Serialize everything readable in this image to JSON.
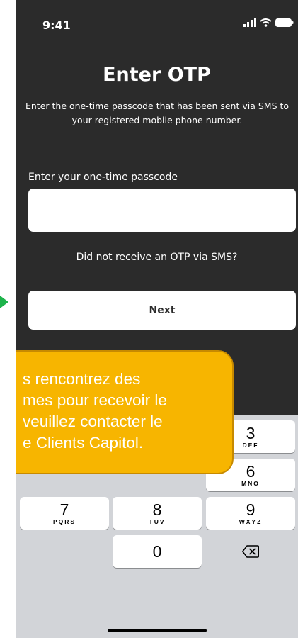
{
  "status_bar": {
    "time": "9:41",
    "icons": [
      "signal-icon",
      "wifi-icon",
      "battery-icon"
    ]
  },
  "screen": {
    "title": "Enter OTP",
    "subtitle_line1": "Enter the one-time passcode that has been sent via SMS to",
    "subtitle_line2": "your registered mobile phone number.",
    "field_label": "Enter your one-time passcode",
    "otp_value": "",
    "resend_link": "Did not receive an OTP via SMS?",
    "next_label": "Next"
  },
  "keyboard": {
    "key_3": {
      "num": "3",
      "letters": "DEF"
    },
    "key_6": {
      "num": "6",
      "letters": "MNO"
    },
    "key_7": {
      "num": "7",
      "letters": "PQRS"
    },
    "key_8": {
      "num": "8",
      "letters": "TUV"
    },
    "key_9": {
      "num": "9",
      "letters": "WXYZ"
    },
    "key_0": {
      "num": "0"
    },
    "delete_icon": "backspace-icon"
  },
  "callout": {
    "line1": "s rencontrez des",
    "line2": "mes pour recevoir le",
    "line3": "veuillez contacter le",
    "line4": "e Clients Capitol."
  },
  "colors": {
    "screen_bg": "#2b2b2b",
    "keyboard_bg": "#d2d4d8",
    "callout_bg": "#f7b500",
    "arrow": "#1db34b"
  }
}
